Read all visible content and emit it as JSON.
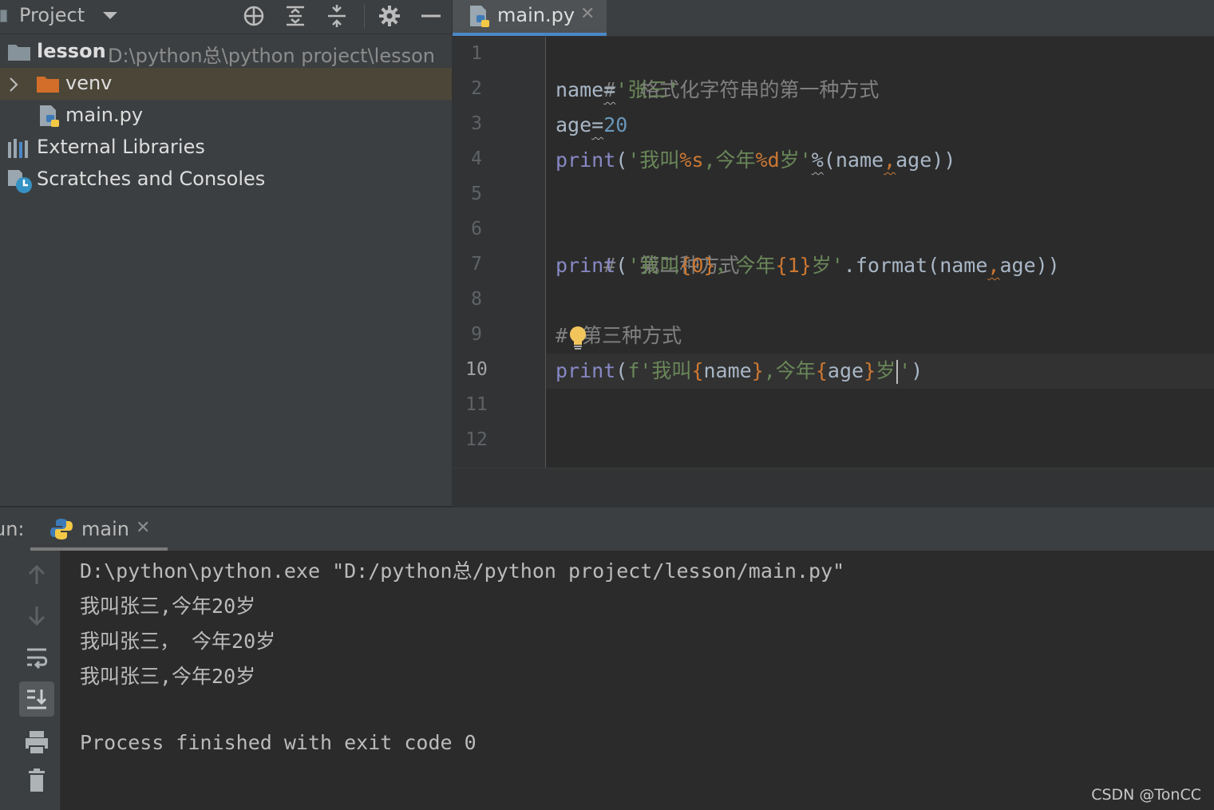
{
  "project_panel": {
    "title": "Project",
    "tree": {
      "root_name": "lesson",
      "root_path": "D:\\python总\\python project\\lesson",
      "venv": "venv",
      "main_file": "main.py",
      "external_libraries": "External Libraries",
      "scratches": "Scratches and Consoles"
    }
  },
  "editor": {
    "tab_label": "main.py",
    "tab_close": "✕",
    "current_line": 10,
    "line_numbers": [
      "1",
      "2",
      "3",
      "4",
      "5",
      "6",
      "7",
      "8",
      "9",
      "10",
      "11",
      "12"
    ],
    "code": {
      "l1": "#  格式化字符串的第一种方式",
      "l2_a": "name",
      "l2_b": "=",
      "l2_c": "'张三'",
      "l3_a": "age",
      "l3_b": "=",
      "l3_c": "20",
      "l4_a": "print",
      "l4_b": "(",
      "l4_c": "'我叫",
      "l4_d": "%s",
      "l4_e": ",今年",
      "l4_f": "%d",
      "l4_g": "岁'",
      "l4_h": "%",
      "l4_i": "(name",
      "l4_j": ",",
      "l4_k": "age))",
      "l6": "#  第二种方式",
      "l7_a": "print",
      "l7_b": "(",
      "l7_c": "'我叫",
      "l7_d": "{0}",
      "l7_e": "，今年",
      "l7_f": "{1}",
      "l7_g": "岁'",
      "l7_h": ".format(name",
      "l7_i": ",",
      "l7_j": "age))",
      "l9_a": "#",
      "l9_b": "第三种方式",
      "l10_a": "print",
      "l10_b": "(",
      "l10_c": "f'我叫",
      "l10_d": "{",
      "l10_e": "name",
      "l10_f": "}",
      "l10_g": ",今年",
      "l10_h": "{",
      "l10_i": "age",
      "l10_j": "}",
      "l10_k": "岁",
      "l10_l": "'",
      "l10_m": ")"
    }
  },
  "run_panel": {
    "label": "un:",
    "tab_label": "main",
    "tab_close": "✕",
    "output": [
      "D:\\python\\python.exe \"D:/python总/python project/lesson/main.py\"",
      "我叫张三,今年20岁",
      "我叫张三， 今年20岁",
      "我叫张三,今年20岁",
      "Process finished with exit code 0"
    ]
  },
  "watermark": "CSDN @TonCC"
}
